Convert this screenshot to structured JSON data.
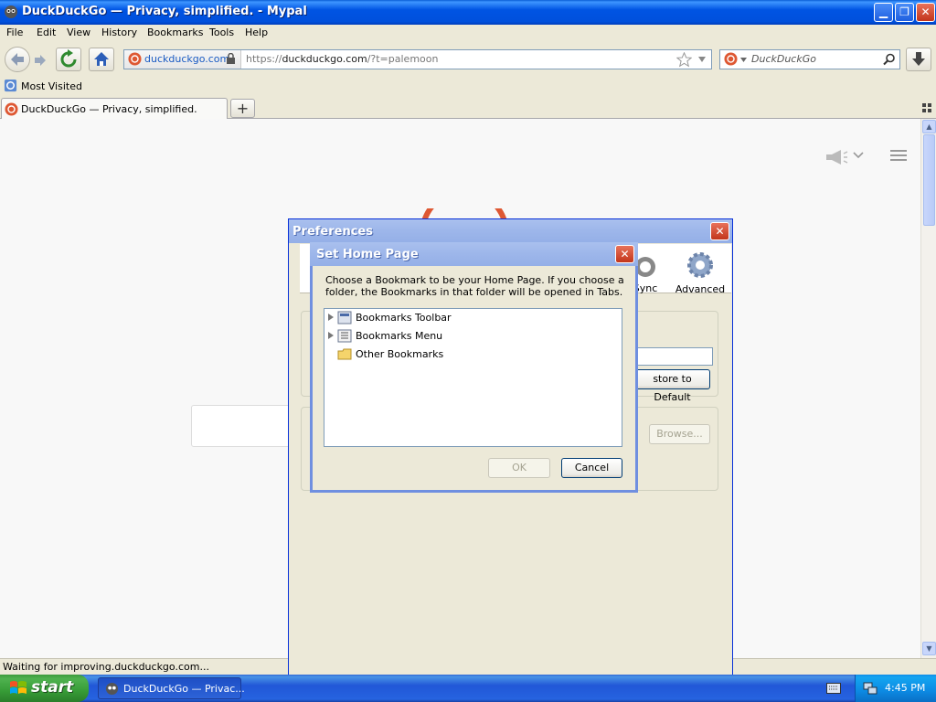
{
  "window": {
    "title": "DuckDuckGo — Privacy, simplified. - Mypal",
    "min_glyph": "▁",
    "max_glyph": "❐",
    "close_glyph": "✕"
  },
  "menu": {
    "file": "File",
    "edit": "Edit",
    "view": "View",
    "history": "History",
    "bookmarks": "Bookmarks",
    "tools": "Tools",
    "help": "Help"
  },
  "nav": {
    "url_domain": "duckduckgo.com",
    "url_scheme": "https://",
    "url_host": "duckduckgo.com",
    "url_rest": "/?t=palemoon",
    "search_placeholder": "DuckDuckGo"
  },
  "bookmarks_toolbar": {
    "most_visited": "Most Visited"
  },
  "tabs": {
    "active_label": "DuckDuckGo — Privacy, simplified.",
    "new_tab_glyph": "+"
  },
  "status": {
    "text": "Waiting for improving.duckduckgo.com..."
  },
  "preferences": {
    "title": "Preferences",
    "close_glyph": "✕",
    "sync_label": "Sync",
    "advanced_label": "Advanced",
    "restore_default_label": "store to Default",
    "browse_label": "Browse..."
  },
  "set_home_page": {
    "title": "Set Home Page",
    "close_glyph": "✕",
    "message": "Choose a Bookmark to be your Home Page. If you choose a folder, the Bookmarks in that folder will be opened in Tabs.",
    "tree": [
      {
        "label": "Bookmarks Toolbar",
        "expandable": true
      },
      {
        "label": "Bookmarks Menu",
        "expandable": true
      },
      {
        "label": "Other Bookmarks",
        "expandable": false
      }
    ],
    "ok_label": "OK",
    "cancel_label": "Cancel"
  },
  "taskbar": {
    "start_label": "start",
    "task_label": "DuckDuckGo — Privac...",
    "clock": "4:45 PM"
  },
  "colors": {
    "xp_blue": "#0054e3",
    "start_green": "#379c37",
    "ddg_orange": "#de5833"
  }
}
